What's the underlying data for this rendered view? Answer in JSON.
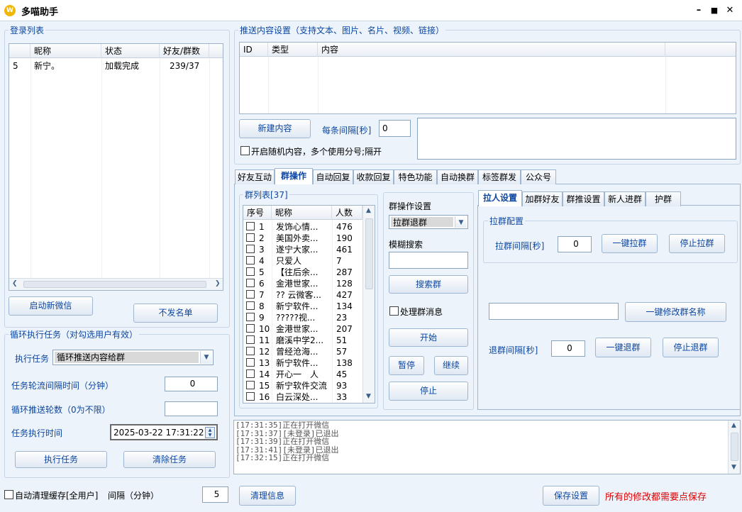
{
  "window": {
    "title": "多喵助手",
    "logo": "W"
  },
  "login_list": {
    "title": "登录列表",
    "columns": [
      "昵称",
      "状态",
      "好友/群数"
    ],
    "rows": [
      {
        "id": "5",
        "nick": "新宁。",
        "status": "加载完成",
        "count": "239/37"
      }
    ],
    "start_btn": "启动新微信",
    "blacklist_btn": "不发名单"
  },
  "loop_task": {
    "title": "循环执行任务（对勾选用户有效）",
    "exec_label": "执行任务",
    "exec_value": "循环推送内容给群",
    "interval_label": "任务轮流间隔时间（分钟）",
    "interval_value": "0",
    "rounds_label": "循环推送轮数（0为不限）",
    "rounds_value": "",
    "time_label": "任务执行时间",
    "time_value": "2025-03-22 17:31:22",
    "exec_btn": "执行任务",
    "clear_btn": "清除任务"
  },
  "bottom_left": {
    "auto_clean_label": "自动清理缓存[全用户]",
    "interval_label": "间隔（分钟）",
    "interval_value": "5"
  },
  "push": {
    "title": "推送内容设置（支持文本、图片、名片、视频、链接）",
    "columns": [
      "ID",
      "类型",
      "内容"
    ],
    "new_btn": "新建内容",
    "interval_label": "每条间隔[秒]",
    "interval_value": "0",
    "random_label": "开启随机内容，多个使用分号;隔开"
  },
  "tabs": [
    "好友互动",
    "群操作",
    "自动回复",
    "收款回复",
    "特色功能",
    "自动换群",
    "标签群发",
    "公众号"
  ],
  "group_list": {
    "title": "群列表[37]",
    "columns": [
      "序号",
      "昵称",
      "人数"
    ],
    "rows": [
      {
        "n": "1",
        "name": "发饰心情...",
        "c": "476"
      },
      {
        "n": "2",
        "name": "美国外卖...",
        "c": "190"
      },
      {
        "n": "3",
        "name": "遂宁大家...",
        "c": "461"
      },
      {
        "n": "4",
        "name": "只爱人",
        "c": "7"
      },
      {
        "n": "5",
        "name": "【往后余...",
        "c": "287"
      },
      {
        "n": "6",
        "name": "金港世家...",
        "c": "128"
      },
      {
        "n": "7",
        "name": "?? 云微客...",
        "c": "427"
      },
      {
        "n": "8",
        "name": "新宁软件...",
        "c": "134"
      },
      {
        "n": "9",
        "name": "?????视...",
        "c": "23"
      },
      {
        "n": "10",
        "name": "金港世家...",
        "c": "207"
      },
      {
        "n": "11",
        "name": "磨溪中学2...",
        "c": "51"
      },
      {
        "n": "12",
        "name": "曾经沧海...",
        "c": "57"
      },
      {
        "n": "13",
        "name": "新宁软件...",
        "c": "138"
      },
      {
        "n": "14",
        "name": "开心一　人",
        "c": "45"
      },
      {
        "n": "15",
        "name": "新宁软件交流",
        "c": "93"
      },
      {
        "n": "16",
        "name": "白云深处...",
        "c": "33"
      }
    ]
  },
  "group_ops": {
    "title": "群操作设置",
    "op_value": "拉群退群",
    "search_label": "模糊搜索",
    "search_btn": "搜索群",
    "handle_msg_label": "处理群消息",
    "start_btn": "开始",
    "pause_btn": "暂停",
    "continue_btn": "继续",
    "stop_btn": "停止"
  },
  "subtabs": [
    "拉人设置",
    "加群好友",
    "群推设置",
    "新人进群",
    "护群"
  ],
  "pull_config": {
    "title": "拉群配置",
    "interval_label": "拉群间隔[秒]",
    "interval_value": "0",
    "pull_btn": "一键拉群",
    "stop_pull_btn": "停止拉群",
    "rename_value": "",
    "rename_btn": "一键修改群名称",
    "quit_label": "退群间隔[秒]",
    "quit_value": "0",
    "quit_btn": "一键退群",
    "stop_quit_btn": "停止退群"
  },
  "log": {
    "lines": [
      "[17:31:35]正在打开微信",
      "[17:31:37][未登录]已退出",
      "[17:31:39]正在打开微信",
      "[17:31:41][未登录]已退出",
      "[17:32:15]正在打开微信"
    ]
  },
  "footer": {
    "clear_btn": "清理信息",
    "save_btn": "保存设置",
    "note": "所有的修改都需要点保存",
    "note_color": "#e00000"
  }
}
